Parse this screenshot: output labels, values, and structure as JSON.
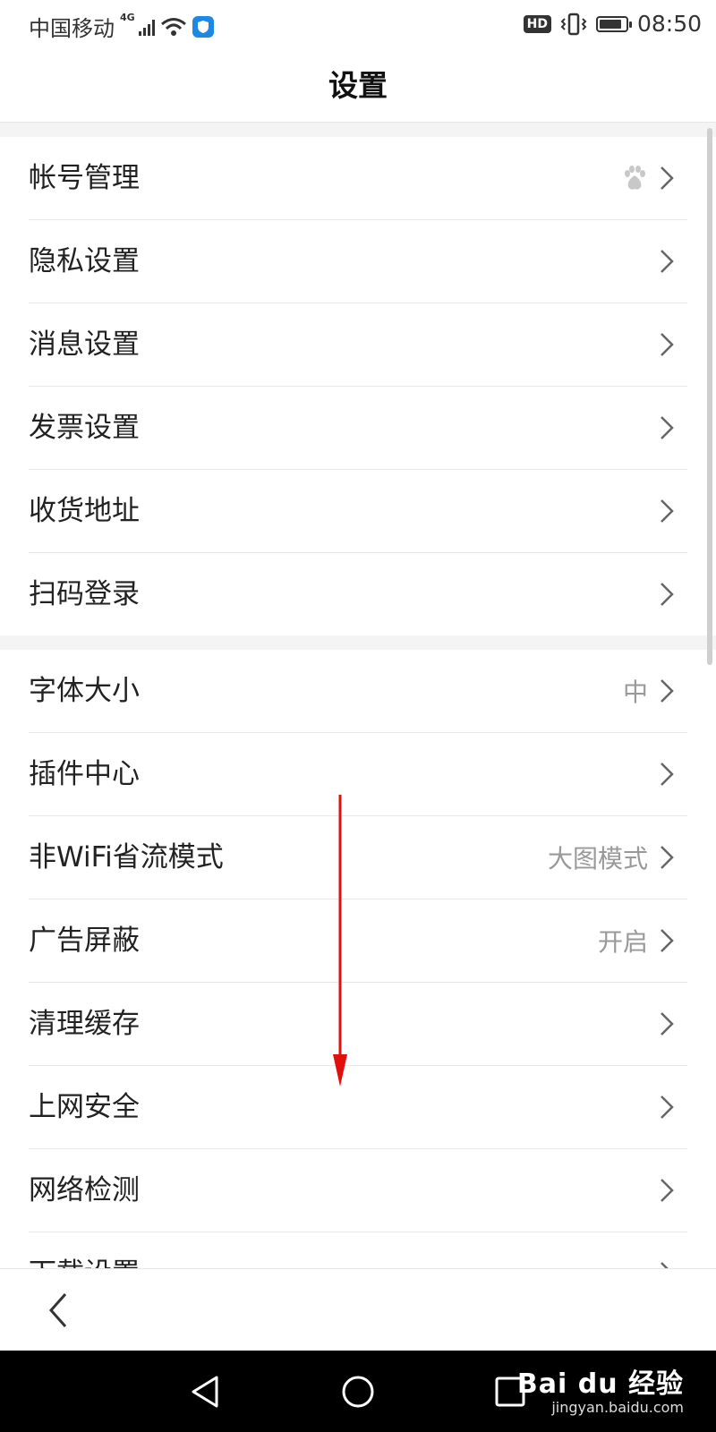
{
  "status_bar": {
    "carrier": "中国移动",
    "network": "4G",
    "hd": "HD",
    "time": "08:50"
  },
  "header": {
    "title": "设置"
  },
  "groups": [
    {
      "items": [
        {
          "label": "帐号管理",
          "value": "",
          "icon": "baidu-paw-icon"
        },
        {
          "label": "隐私设置",
          "value": ""
        },
        {
          "label": "消息设置",
          "value": ""
        },
        {
          "label": "发票设置",
          "value": ""
        },
        {
          "label": "收货地址",
          "value": ""
        },
        {
          "label": "扫码登录",
          "value": ""
        }
      ]
    },
    {
      "items": [
        {
          "label": "字体大小",
          "value": "中"
        },
        {
          "label": "插件中心",
          "value": ""
        },
        {
          "label": "非WiFi省流模式",
          "value": "大图模式"
        },
        {
          "label": "广告屏蔽",
          "value": "开启"
        },
        {
          "label": "清理缓存",
          "value": ""
        },
        {
          "label": "上网安全",
          "value": ""
        },
        {
          "label": "网络检测",
          "value": ""
        },
        {
          "label": "下载设置",
          "value": ""
        }
      ]
    }
  ],
  "watermark": {
    "main": "Bai du 经验",
    "sub": "jingyan.baidu.com"
  },
  "colors": {
    "annotation_arrow": "#e01010",
    "nav_bar": "#000000",
    "chevron": "#666666"
  }
}
